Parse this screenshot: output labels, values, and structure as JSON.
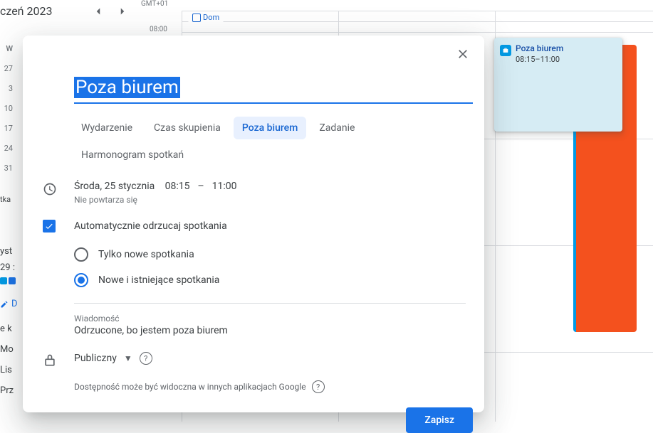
{
  "bg": {
    "month": "czeń 2023",
    "tz": "GMT+01",
    "timeLabel": "08:00",
    "weekHeader": "W",
    "days": [
      "27",
      "3",
      "10",
      "17",
      "24",
      "31"
    ],
    "domChip": "Dom",
    "sideFragments": {
      "yst": "yst",
      "day29": "29 :",
      "tka": "tka",
      "d": "D",
      "ek": "e k",
      "mo": "Mo",
      "lis": "Lis",
      "prz": "Prz"
    }
  },
  "card": {
    "title": "Poza biurem",
    "time": "08:15–11:00"
  },
  "dialog": {
    "title": "Poza biurem",
    "tabs": {
      "event": "Wydarzenie",
      "focus": "Czas skupienia",
      "ooo": "Poza biurem",
      "task": "Zadanie",
      "schedule": "Harmonogram spotkań"
    },
    "activeTab": "ooo",
    "date": "Środa, 25 stycznia",
    "timeStart": "08:15",
    "timeSep": "–",
    "timeEnd": "11:00",
    "recurrence": "Nie powtarza się",
    "autoDeclineLabel": "Automatycznie odrzucaj spotkania",
    "radio": {
      "onlyNew": "Tylko nowe spotkania",
      "newAndExisting": "Nowe i istniejące spotkania"
    },
    "message": {
      "label": "Wiadomość",
      "text": "Odrzucone, bo jestem poza biurem"
    },
    "visibility": "Publiczny",
    "availabilityNote": "Dostępność może być widoczna w innych aplikacjach Google",
    "saveButton": "Zapisz"
  }
}
